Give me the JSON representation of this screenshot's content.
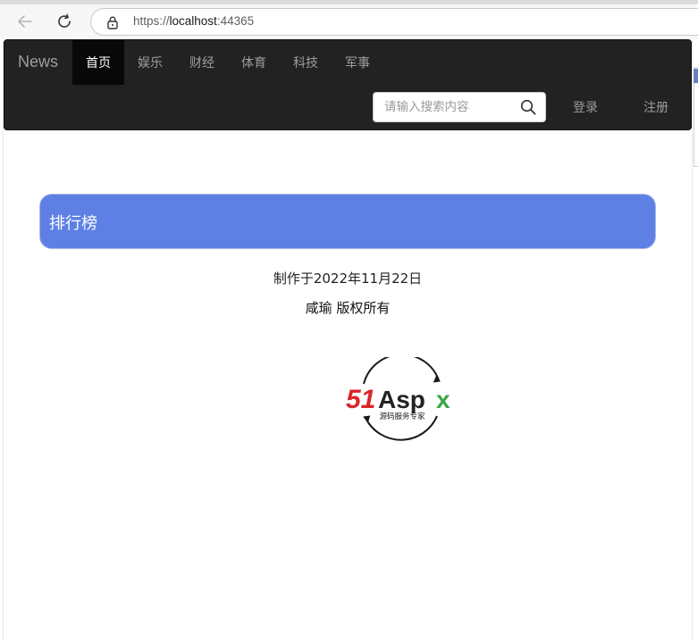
{
  "browser": {
    "url_protocol": "https://",
    "url_host": "localhost",
    "url_port": ":44365",
    "back_icon": "arrow-left-icon",
    "refresh_icon": "refresh-icon",
    "lock_icon": "lock-icon"
  },
  "navbar": {
    "brand": "News",
    "items": [
      {
        "label": "首页",
        "active": true
      },
      {
        "label": "娱乐",
        "active": false
      },
      {
        "label": "财经",
        "active": false
      },
      {
        "label": "体育",
        "active": false
      },
      {
        "label": "科技",
        "active": false
      },
      {
        "label": "军事",
        "active": false
      }
    ],
    "search_placeholder": "请输入搜索内容",
    "login": "登录",
    "register": "注册"
  },
  "main": {
    "panel_title": "排行榜",
    "panel_color": "#5e80e4"
  },
  "footer": {
    "made_on": "制作于2022年11月22日",
    "copyright": "咸瑜 版权所有"
  },
  "logo": {
    "brand_part1": "51",
    "brand_part2": "Asp",
    "brand_part3": "x",
    "tagline": "源码服务专家"
  }
}
